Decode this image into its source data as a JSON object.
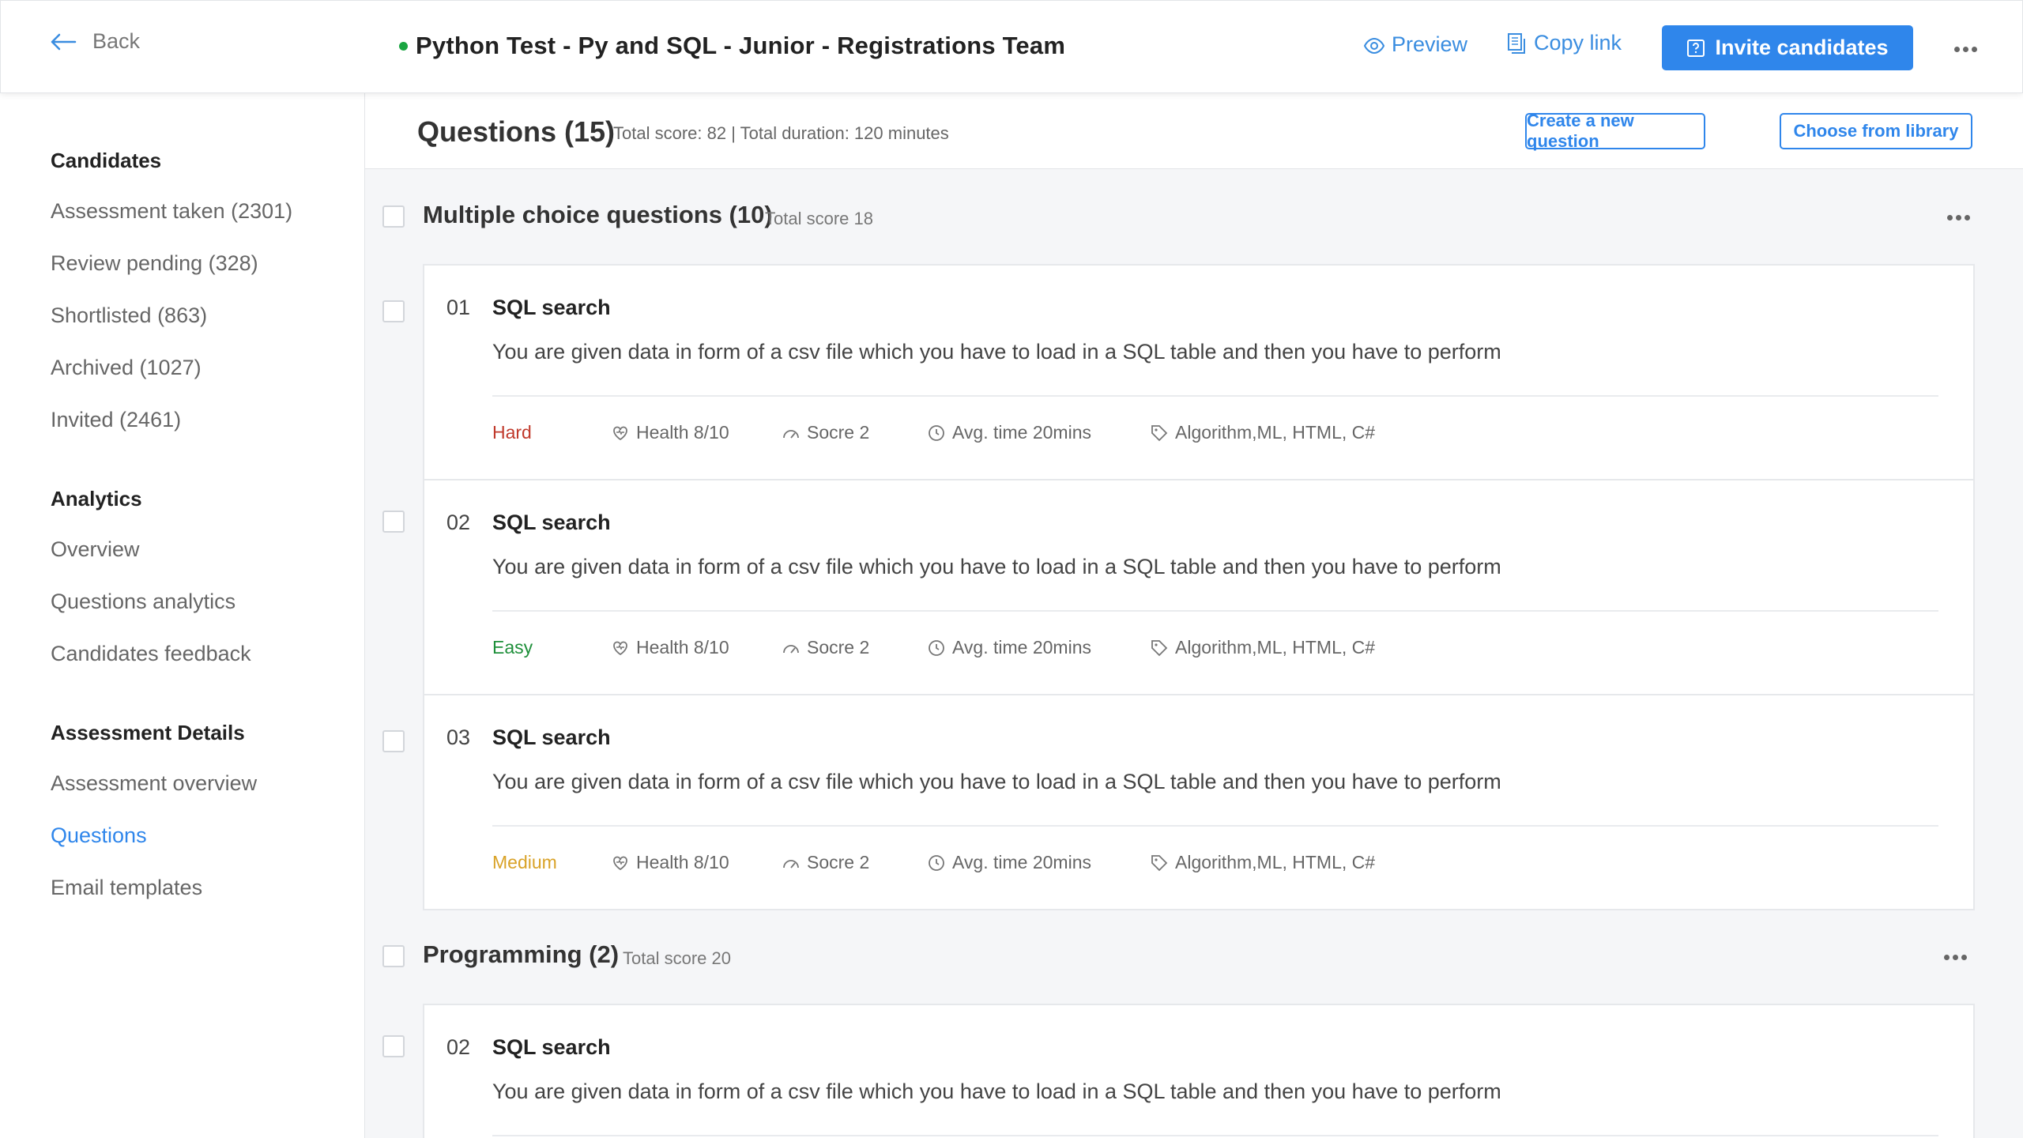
{
  "header": {
    "back_label": "Back",
    "title": "Python Test - Py and SQL - Junior - Registrations Team",
    "status_color": "#1aa541",
    "preview_label": "Preview",
    "copy_link_label": "Copy link",
    "invite_label": "Invite candidates"
  },
  "sidebar": {
    "sections": [
      {
        "heading": "Candidates",
        "items": [
          "Assessment taken (2301)",
          "Review pending (328)",
          "Shortlisted (863)",
          "Archived (1027)",
          "Invited (2461)"
        ]
      },
      {
        "heading": "Analytics",
        "items": [
          "Overview",
          "Questions analytics",
          "Candidates feedback"
        ]
      },
      {
        "heading": "Assessment Details",
        "items": [
          "Assessment overview",
          "Questions",
          "Email templates"
        ]
      }
    ],
    "active_item": "Questions"
  },
  "questions_bar": {
    "title": "Questions (15)",
    "summary": "Total score: 82 | Total duration: 120 minutes",
    "create_label": "Create a new question",
    "library_label": "Choose from library"
  },
  "sections": [
    {
      "title": "Multiple choice questions (10)",
      "score": "Total score 18",
      "questions": [
        {
          "number": "01",
          "name": "SQL search",
          "description": "You are given data in form of a csv file which you have to load in a SQL table and then you have to perform",
          "difficulty": "Hard",
          "difficulty_color": "#c0392b",
          "health": "Health 8/10",
          "score": "Socre 2",
          "avg_time": "Avg. time 20mins",
          "tags": "Algorithm,ML, HTML, C#"
        },
        {
          "number": "02",
          "name": "SQL search",
          "description": "You are given data in form of a csv file which you have to load in a SQL table and then you have to perform",
          "difficulty": "Easy",
          "difficulty_color": "#1e8f3a",
          "health": "Health 8/10",
          "score": "Socre 2",
          "avg_time": "Avg. time 20mins",
          "tags": "Algorithm,ML, HTML, C#"
        },
        {
          "number": "03",
          "name": "SQL search",
          "description": "You are given data in form of a csv file which you have to load in a SQL table and then you have to perform",
          "difficulty": "Medium",
          "difficulty_color": "#d9a227",
          "health": "Health 8/10",
          "score": "Socre 2",
          "avg_time": "Avg. time 20mins",
          "tags": "Algorithm,ML, HTML, C#"
        }
      ]
    },
    {
      "title": "Programming (2)",
      "score": "Total score 20",
      "questions": [
        {
          "number": "02",
          "name": "SQL search",
          "description": "You are given data in form of a csv file which you have to load in a SQL table and then you have to perform"
        }
      ]
    }
  ],
  "icons": [
    "back-arrow-icon",
    "eye-icon",
    "copy-icon",
    "question-box-icon",
    "more-dots-icon",
    "heart-icon",
    "gauge-icon",
    "clock-icon",
    "tag-icon"
  ],
  "colors": {
    "accent": "#2f86eb",
    "link": "#3a8de0"
  }
}
